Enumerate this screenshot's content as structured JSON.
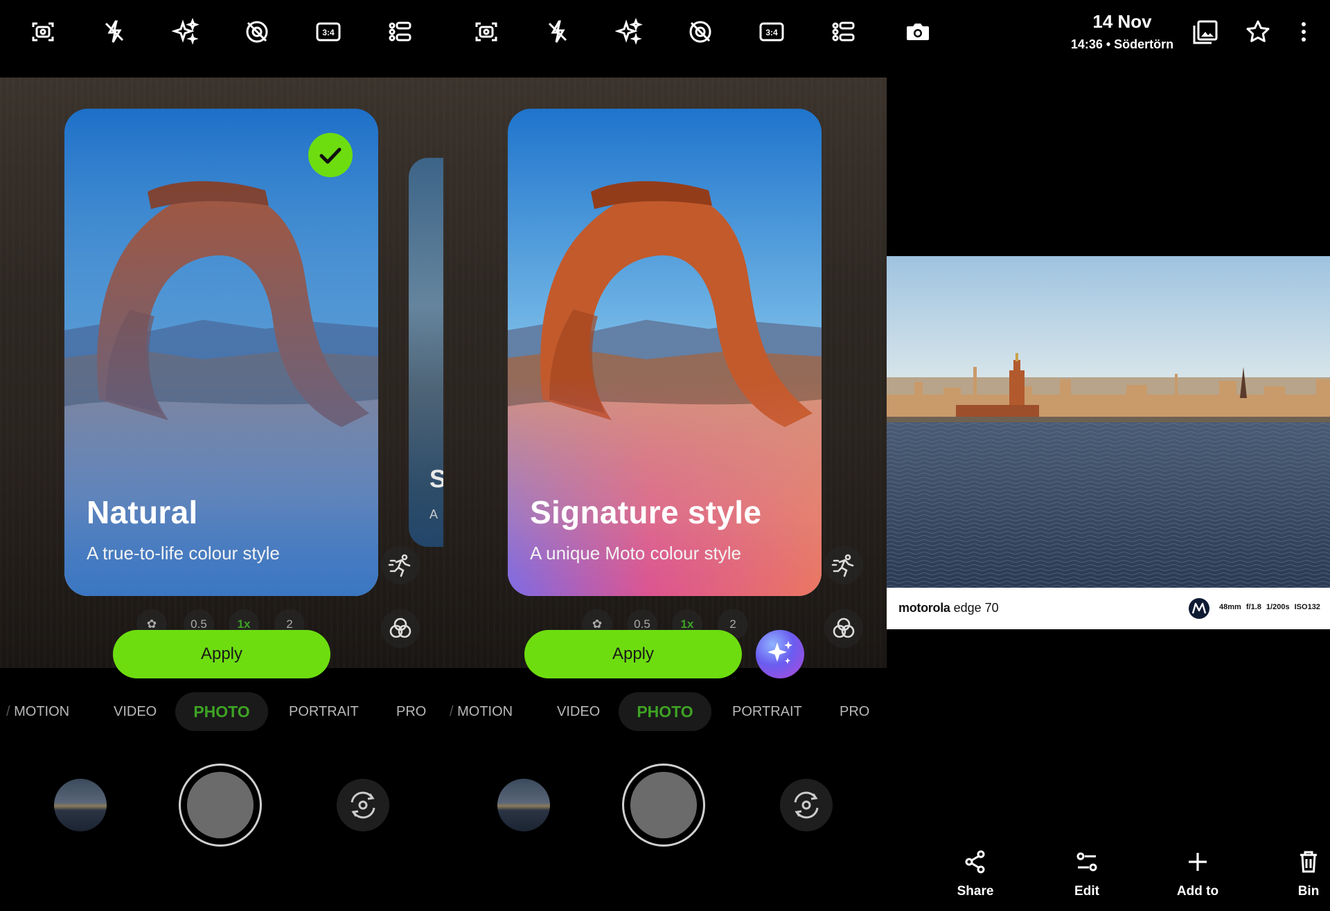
{
  "camera": {
    "cards": [
      {
        "title": "Natural",
        "subtitle": "A true-to-life colour style",
        "selected": true
      },
      {
        "title": "Signature style",
        "subtitle": "A unique Moto colour style",
        "selected": false
      }
    ],
    "peek_letter": "S",
    "peek_sub": "A",
    "apply_label": "Apply",
    "zoom_levels": [
      "0.5",
      "1x",
      "2"
    ],
    "modes": [
      "MOTION",
      "VIDEO",
      "PHOTO",
      "PORTRAIT",
      "PRO"
    ],
    "active_mode": "PHOTO",
    "toolbar_icons": [
      "smart-capture-icon",
      "flash-off-icon",
      "ai-sparkle-icon",
      "motion-off-icon",
      "aspect-ratio-icon",
      "settings-menu-icon"
    ],
    "aspect_ratio": "3:4",
    "accent": "#6ddd10",
    "active_mode_color": "#3ea324"
  },
  "gallery": {
    "date": "14 Nov",
    "time_location": "14:36 • Södertörn",
    "watermark": {
      "brand": "motorola",
      "model": "edge 70",
      "exif": "48mm f/1.8 1/200s ISO132"
    },
    "actions": [
      "Share",
      "Edit",
      "Add to",
      "Bin"
    ]
  }
}
